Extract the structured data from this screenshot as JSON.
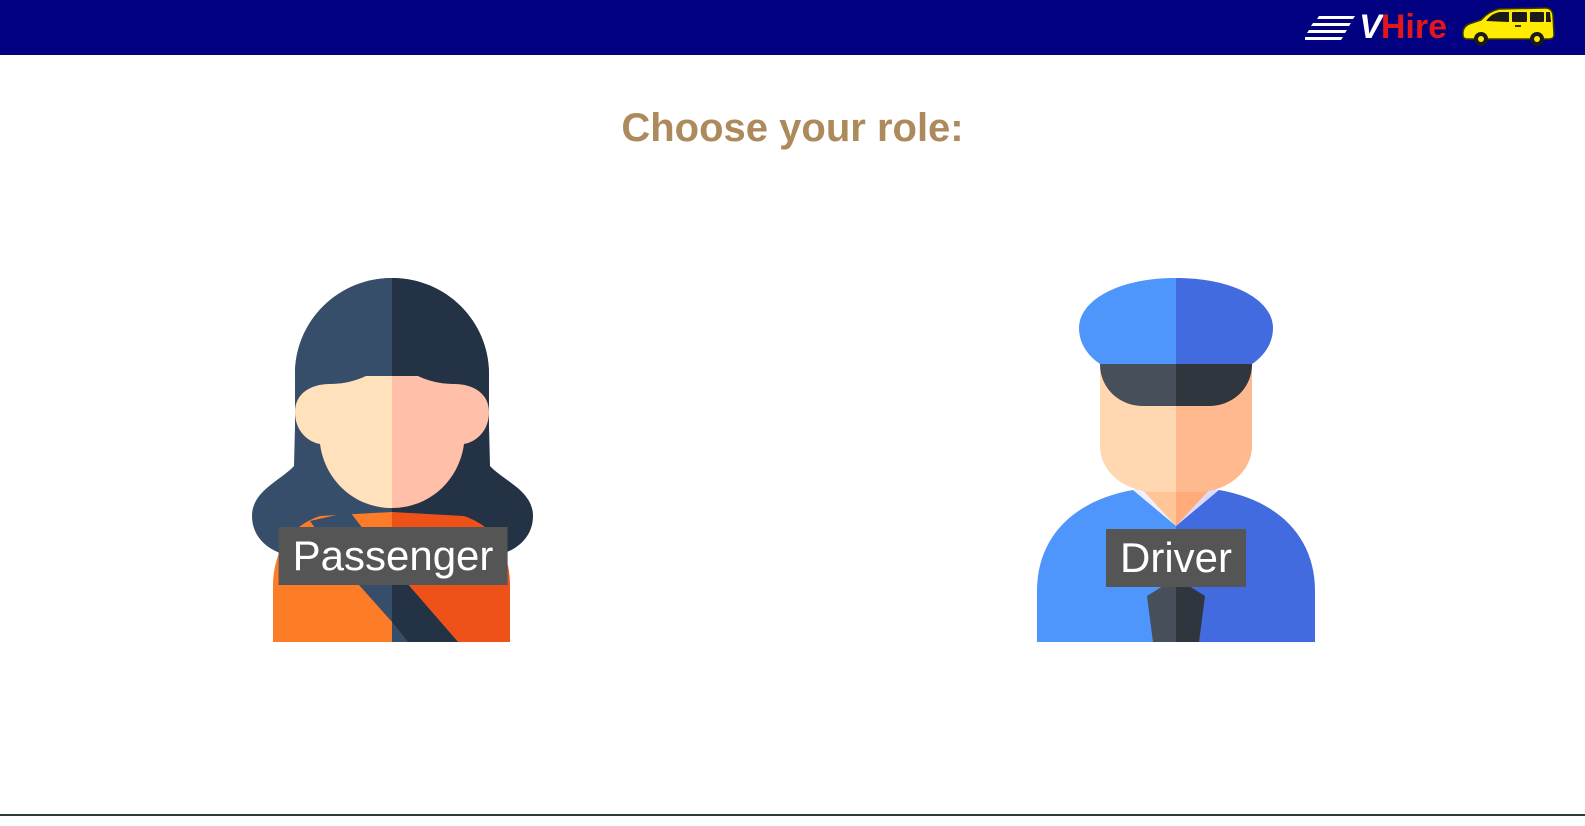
{
  "header": {
    "logo": {
      "brand_v": "V",
      "brand_rest": "Hire",
      "speed_icon": "speed-lines-icon",
      "van_icon": "van-icon"
    },
    "colors": {
      "bar": "#000080",
      "brand_red": "#e3161b",
      "van": "#ffeb00"
    }
  },
  "main": {
    "title": "Choose your role:",
    "roles": [
      {
        "label": "Passenger",
        "icon": "passenger-woman-icon"
      },
      {
        "label": "Driver",
        "icon": "driver-icon"
      }
    ]
  },
  "colors": {
    "title": "#ad8a5c",
    "label_bg": "#555555"
  }
}
